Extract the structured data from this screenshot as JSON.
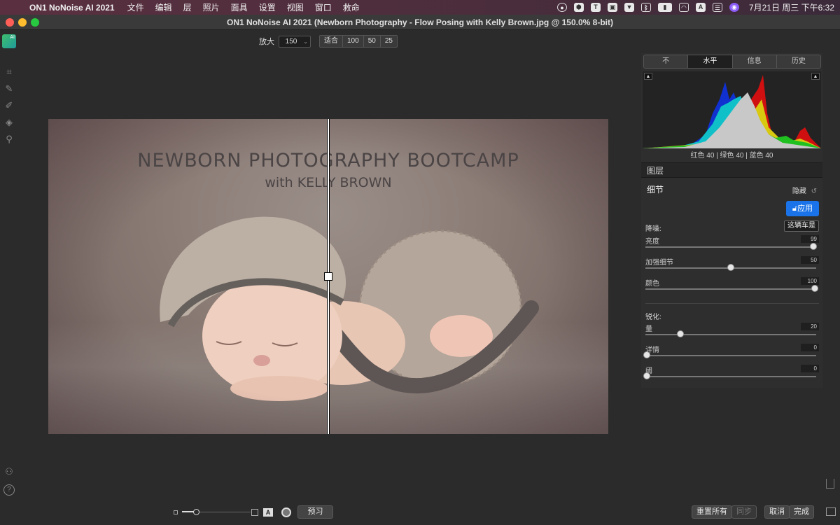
{
  "menubar": {
    "app_name": "ON1 NoNoise AI 2021",
    "items": [
      "文件",
      "编辑",
      "层",
      "照片",
      "面具",
      "设置",
      "视图",
      "窗口",
      "救命"
    ],
    "clock": "7月21日 周三 下午6:32",
    "tray_letter": "A",
    "tray_t": "T"
  },
  "window": {
    "title": "ON1 NoNoise AI 2021 (Newborn Photography -  Flow Posing with Kelly Brown.jpg @ 150.0% 8-bit)"
  },
  "zoom": {
    "label": "放大",
    "value": "150",
    "presets": [
      "适合",
      "100",
      "50",
      "25"
    ]
  },
  "photo": {
    "title": "NEWBORN PHOTOGRAPHY BOOTCAMP",
    "subtitle": "with KELLY BROWN"
  },
  "panel": {
    "tabs": [
      "不",
      "水平",
      "信息",
      "历史"
    ],
    "active_tab": "水平",
    "rgb_readout": "红色  40  | 绿色  40  | 蓝色  40",
    "layers_label": "图层",
    "detail_label": "细节",
    "hide_label": "隐藏",
    "apply_label": "应用",
    "noise_label": "降噪:",
    "preset_label": "这辆车是",
    "sharpen_label": "锐化:",
    "noise_sliders": [
      {
        "label": "亮度",
        "value": "99",
        "fraction": 0.99
      },
      {
        "label": "加强细节",
        "value": "50",
        "fraction": 0.5
      },
      {
        "label": "颜色",
        "value": "100",
        "fraction": 1.0
      }
    ],
    "sharpen_sliders": [
      {
        "label": "量",
        "value": "20",
        "fraction": 0.2
      },
      {
        "label": "详情",
        "value": "0",
        "fraction": 0.0
      },
      {
        "label": "阈",
        "value": "0",
        "fraction": 0.0
      }
    ]
  },
  "bottom": {
    "preview_label": "预习",
    "reset_all_label": "重置所有",
    "sync_label": "同步",
    "cancel_label": "取消",
    "done_label": "完成",
    "a_letter": "A"
  },
  "colors": {
    "accent": "#1a73e8",
    "histogram_red": "#d01010",
    "histogram_green": "#20c020",
    "histogram_blue": "#1030d0",
    "histogram_cyan": "#10c0c8",
    "histogram_yellow": "#d8c810",
    "histogram_gray": "#c8c8c8"
  }
}
